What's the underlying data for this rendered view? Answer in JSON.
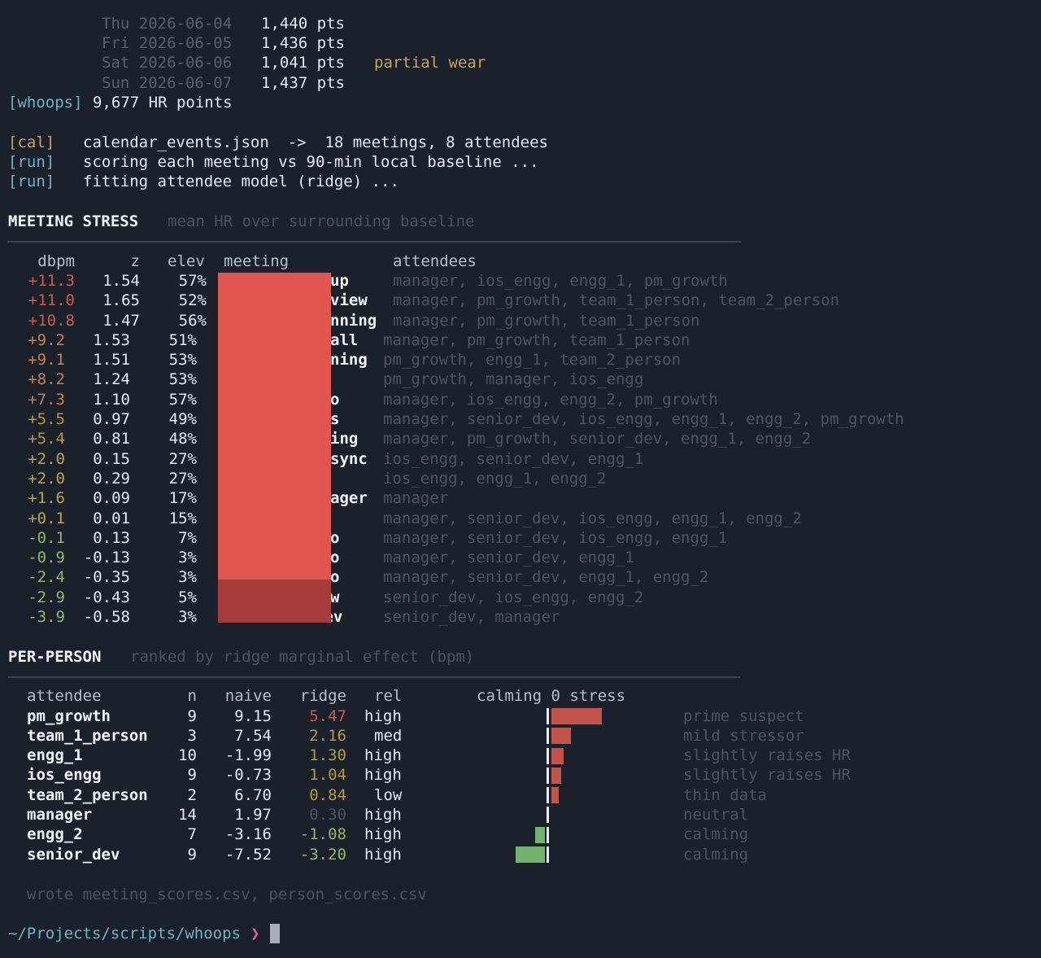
{
  "log_top": {
    "days": [
      {
        "date": "Thu 2026-06-04",
        "pts": "1,440 pts",
        "note": ""
      },
      {
        "date": "Fri 2026-06-05",
        "pts": "1,436 pts",
        "note": ""
      },
      {
        "date": "Sat 2026-06-06",
        "pts": "1,041 pts",
        "note": "partial wear"
      },
      {
        "date": "Sun 2026-06-07",
        "pts": "1,437 pts",
        "note": ""
      }
    ],
    "summary_tag": "[whoops]",
    "summary_text": "9,677 HR points",
    "steps": [
      {
        "tag": "[cal]",
        "text": "calendar_events.json  ->  18 meetings, 8 attendees"
      },
      {
        "tag": "[run]",
        "text": "scoring each meeting vs 90-min local baseline ..."
      },
      {
        "tag": "[run]",
        "text": "fitting attendee model (ridge) ..."
      }
    ]
  },
  "meeting_stress": {
    "title": "MEETING STRESS",
    "subtitle": "mean HR over surrounding baseline",
    "columns": {
      "dbpm": "dbpm",
      "z": "z",
      "elev": "elev",
      "meeting": "meeting",
      "attendees": "attendees"
    },
    "rows": [
      {
        "dbpm": "+11.3",
        "z": "1.54",
        "elev": "57%",
        "meeting_frag": "up",
        "attendees": "manager, ios_engg, engg_1, pm_growth"
      },
      {
        "dbpm": "+11.0",
        "z": "1.65",
        "elev": "52%",
        "meeting_frag": "view",
        "attendees": "manager, pm_growth, team_1_person, team_2_person"
      },
      {
        "dbpm": "+10.8",
        "z": "1.47",
        "elev": "56%",
        "meeting_frag": "nning",
        "attendees": "manager, pm_growth, team_1_person"
      },
      {
        "dbpm": "+9.2",
        "z": "1.53",
        "elev": "51%",
        "meeting_frag": "all",
        "attendees": "manager, pm_growth, team_1_person"
      },
      {
        "dbpm": "+9.1",
        "z": "1.51",
        "elev": "53%",
        "meeting_frag": "ning",
        "attendees": "pm_growth, engg_1, team_2_person"
      },
      {
        "dbpm": "+8.2",
        "z": "1.24",
        "elev": "53%",
        "meeting_frag": "",
        "attendees": "pm_growth, manager, ios_engg"
      },
      {
        "dbpm": "+7.3",
        "z": "1.10",
        "elev": "57%",
        "meeting_frag": "o",
        "attendees": "manager, ios_engg, engg_2, pm_growth"
      },
      {
        "dbpm": "+5.5",
        "z": "0.97",
        "elev": "49%",
        "meeting_frag": "s",
        "attendees": "manager, senior_dev, ios_engg, engg_1, engg_2, pm_growth"
      },
      {
        "dbpm": "+5.4",
        "z": "0.81",
        "elev": "48%",
        "meeting_frag": "ing",
        "attendees": "manager, pm_growth, senior_dev, engg_1, engg_2"
      },
      {
        "dbpm": "+2.0",
        "z": "0.15",
        "elev": "27%",
        "meeting_frag": "sync",
        "attendees": "ios_engg, senior_dev, engg_1"
      },
      {
        "dbpm": "+2.0",
        "z": "0.29",
        "elev": "27%",
        "meeting_frag": "",
        "attendees": "ios_engg, engg_1, engg_2"
      },
      {
        "dbpm": "+1.6",
        "z": "0.09",
        "elev": "17%",
        "meeting_frag": "ager",
        "attendees": "manager"
      },
      {
        "dbpm": "+0.1",
        "z": "0.01",
        "elev": "15%",
        "meeting_frag": "",
        "attendees": "manager, senior_dev, ios_engg, engg_1, engg_2"
      },
      {
        "dbpm": "-0.1",
        "z": "0.13",
        "elev": "7%",
        "meeting_frag": "o",
        "attendees": "manager, senior_dev, ios_engg, engg_1"
      },
      {
        "dbpm": "-0.9",
        "z": "-0.13",
        "elev": "3%",
        "meeting_frag": "o",
        "attendees": "manager, senior_dev, engg_1"
      },
      {
        "dbpm": "-2.4",
        "z": "-0.35",
        "elev": "3%",
        "meeting_frag": "o",
        "attendees": "manager, senior_dev, engg_1, engg_2"
      },
      {
        "dbpm": "-2.9",
        "z": "-0.43",
        "elev": "5%",
        "meeting_frag": "w",
        "attendees": "senior_dev, ios_engg, engg_2"
      },
      {
        "dbpm": "-3.9",
        "z": "-0.58",
        "elev": "3%",
        "meeting_frag": "dev",
        "attendees": "senior_dev, manager"
      }
    ]
  },
  "per_person": {
    "title": "PER-PERSON",
    "subtitle": "ranked by ridge marginal effect (bpm)",
    "columns": {
      "attendee": "attendee",
      "n": "n",
      "naive": "naive",
      "ridge": "ridge",
      "rel": "rel",
      "chart": "calming 0 stress"
    },
    "rows": [
      {
        "attendee": "pm_growth",
        "n": "9",
        "naive": "9.15",
        "ridge": "5.47",
        "rel": "high",
        "verdict": "prime suspect",
        "effect": 5.47
      },
      {
        "attendee": "team_1_person",
        "n": "3",
        "naive": "7.54",
        "ridge": "2.16",
        "rel": "med",
        "verdict": "mild stressor",
        "effect": 2.16
      },
      {
        "attendee": "engg_1",
        "n": "10",
        "naive": "-1.99",
        "ridge": "1.30",
        "rel": "high",
        "verdict": "slightly raises HR",
        "effect": 1.3
      },
      {
        "attendee": "ios_engg",
        "n": "9",
        "naive": "-0.73",
        "ridge": "1.04",
        "rel": "high",
        "verdict": "slightly raises HR",
        "effect": 1.04
      },
      {
        "attendee": "team_2_person",
        "n": "2",
        "naive": "6.70",
        "ridge": "0.84",
        "rel": "low",
        "verdict": "thin data",
        "effect": 0.84
      },
      {
        "attendee": "manager",
        "n": "14",
        "naive": "1.97",
        "ridge": "0.30",
        "rel": "high",
        "verdict": "neutral",
        "effect": 0.3
      },
      {
        "attendee": "engg_2",
        "n": "7",
        "naive": "-3.16",
        "ridge": "-1.08",
        "rel": "high",
        "verdict": "calming",
        "effect": -1.08
      },
      {
        "attendee": "senior_dev",
        "n": "9",
        "naive": "-7.52",
        "ridge": "-3.20",
        "rel": "high",
        "verdict": "calming",
        "effect": -3.2
      }
    ]
  },
  "footer": {
    "wrote": "wrote meeting_scores.csv, person_scores.csv",
    "prompt_path": "~/Projects/scripts/whoops",
    "prompt_arrow": "❯"
  },
  "colors": {
    "background": "#1b212b",
    "stress_bar": "#c3544b",
    "calm_bar": "#72b46e",
    "redaction": "#e05550"
  }
}
